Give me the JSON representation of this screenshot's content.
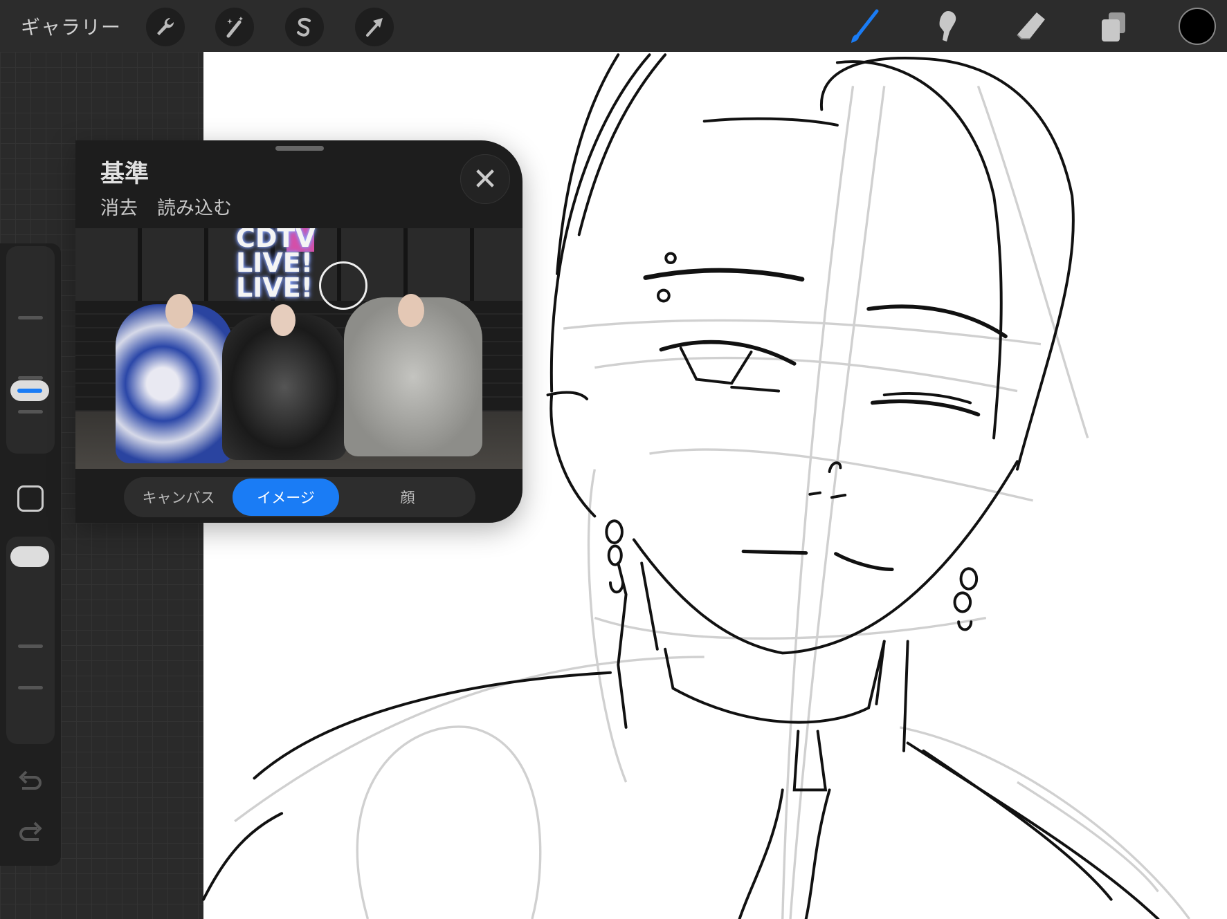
{
  "topbar": {
    "gallery_label": "ギャラリー",
    "left_tools": [
      "wrench-icon",
      "magic-wand-icon",
      "selection-icon",
      "transform-arrow-icon"
    ],
    "right_tools": [
      "brush-icon",
      "smudge-icon",
      "eraser-icon",
      "layers-icon"
    ],
    "active_tool": "brush",
    "accent": "#1a7cf5",
    "current_color": "#000000"
  },
  "reference_panel": {
    "title": "基準",
    "actions": {
      "clear": "消去",
      "import": "読み込む"
    },
    "image_sign": {
      "line1": "CDTV",
      "line2": "LIVE!",
      "line3": "LIVE!"
    },
    "segments": [
      "キャンバス",
      "イメージ",
      "顔"
    ],
    "selected_segment": "イメージ"
  },
  "sidebar": {
    "brush_size_level": 0.62,
    "opacity_level": 0.1
  }
}
